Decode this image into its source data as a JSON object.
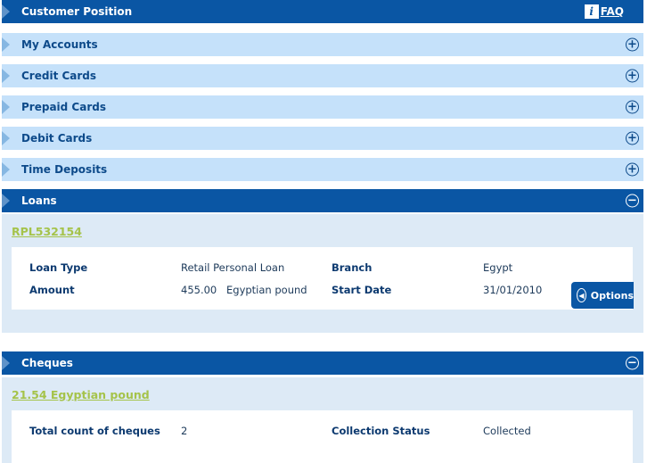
{
  "header": {
    "title": "Customer Position",
    "faq_label": "FAQ",
    "faq_icon": "info-icon"
  },
  "sections": {
    "my_accounts": "My Accounts",
    "credit_cards": "Credit Cards",
    "prepaid_cards": "Prepaid Cards",
    "debit_cards": "Debit Cards",
    "time_deposits": "Time Deposits",
    "loans": "Loans",
    "cheques": "Cheques"
  },
  "toggle": {
    "expand": "+",
    "collapse": "−"
  },
  "loans": {
    "reference": "RPL532154",
    "loan_type_label": "Loan Type",
    "loan_type_value": "Retail Personal Loan",
    "branch_label": "Branch",
    "branch_value": "Egypt",
    "amount_label": "Amount",
    "amount_value": "455.00",
    "amount_currency": "Egyptian pound",
    "start_date_label": "Start Date",
    "start_date_value": "31/01/2010",
    "options_label": "Options"
  },
  "cheques": {
    "total_amount": "21.54 Egyptian pound",
    "total_count_label": "Total count of cheques",
    "total_count_value": "2",
    "collection_status_label": "Collection Status",
    "collection_status_value": "Collected"
  },
  "colors": {
    "dark_bar": "#0a56a4",
    "light_bar": "#c5e1fa",
    "panel": "#ddeaf6",
    "link_green": "#a5c34a"
  }
}
